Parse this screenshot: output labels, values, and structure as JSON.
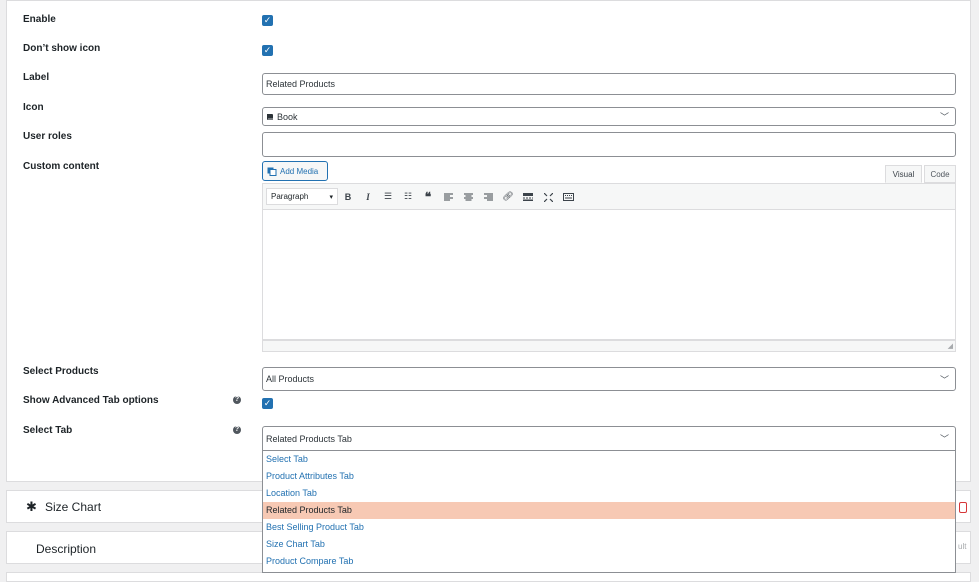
{
  "form": {
    "enable": {
      "label": "Enable",
      "checked": true
    },
    "dont_show_icon": {
      "label": "Don’t show icon",
      "checked": true
    },
    "label_field": {
      "label": "Label",
      "value": "Related Products"
    },
    "icon": {
      "label": "Icon",
      "value": "Book",
      "icon_name": "book-icon"
    },
    "user_roles": {
      "label": "User roles",
      "value": ""
    },
    "custom_content": {
      "label": "Custom content",
      "add_media": "Add Media",
      "tabs": [
        "Visual",
        "Code"
      ],
      "active_tab": "Visual",
      "format": "Paragraph"
    },
    "select_products": {
      "label": "Select Products",
      "value": "All Products"
    },
    "advanced": {
      "label": "Show Advanced Tab options",
      "checked": true
    },
    "select_tab": {
      "label": "Select Tab",
      "value": "Related Products Tab",
      "options": [
        "Select Tab",
        "Product Attributes Tab",
        "Location Tab",
        "Related Products Tab",
        "Best Selling Product Tab",
        "Size Chart Tab",
        "Product Compare Tab"
      ],
      "highlighted_index": 3
    }
  },
  "sections": [
    {
      "title": "Size Chart",
      "icon_name": "gear-icon"
    },
    {
      "title": "Description"
    }
  ],
  "partial_text": {
    "default_suffix": "ult"
  },
  "colors": {
    "accent": "#2271b1",
    "highlight": "#f7c9b4"
  }
}
